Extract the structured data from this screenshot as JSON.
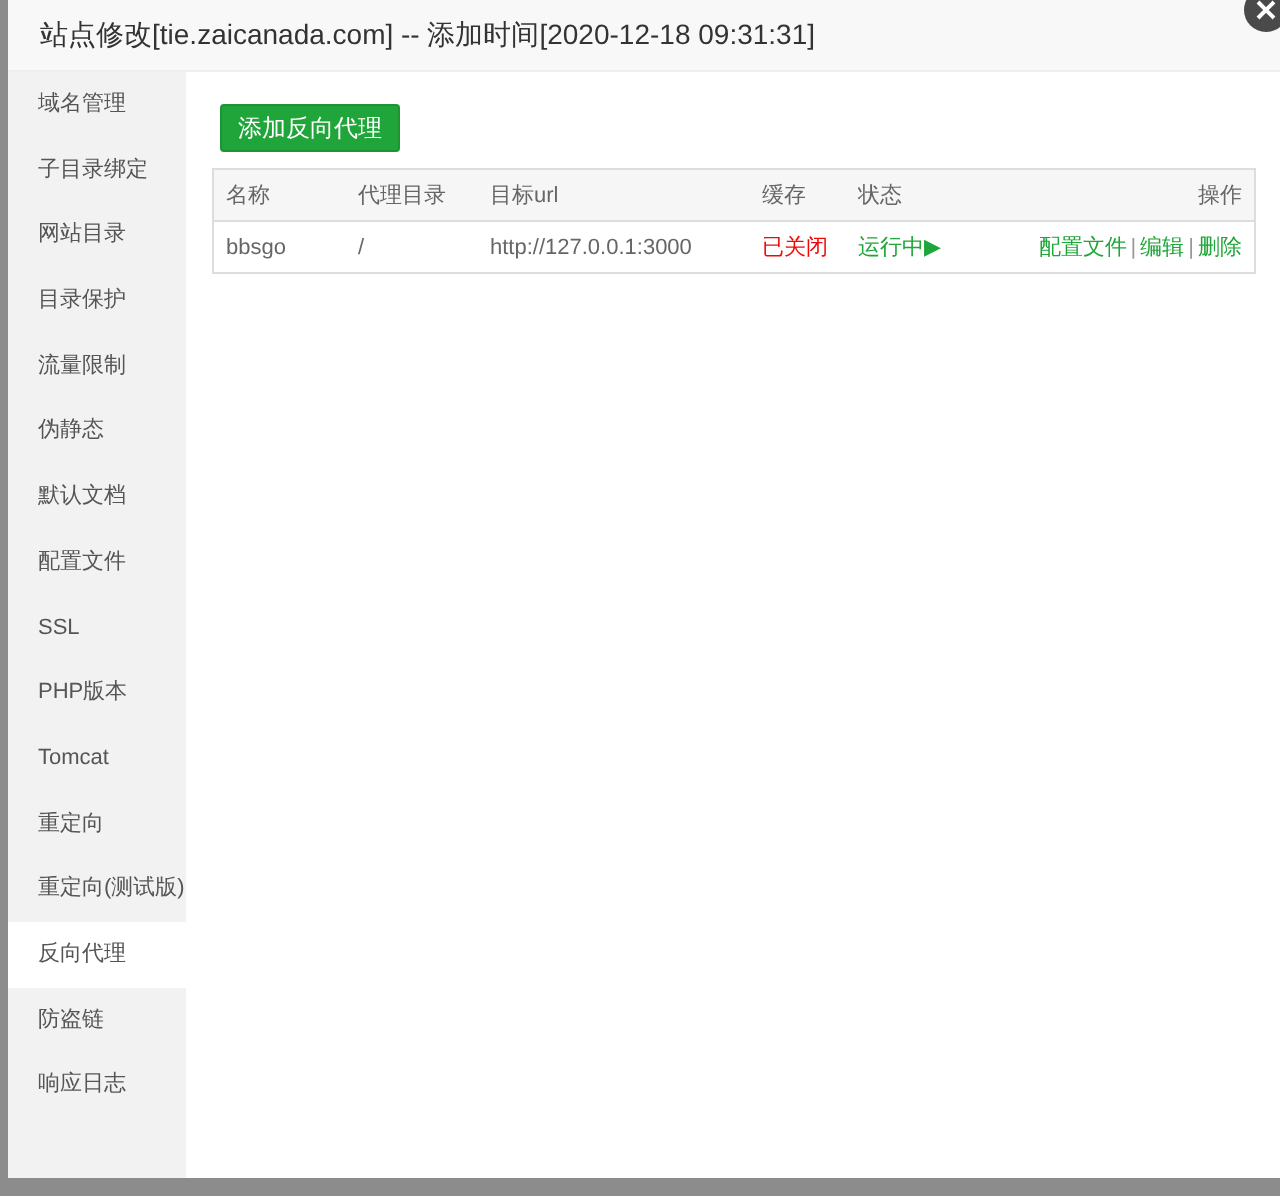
{
  "window": {
    "title": "站点修改[tie.zaicanada.com] -- 添加时间[2020-12-18 09:31:31]"
  },
  "sidebar": {
    "items": [
      {
        "label": "域名管理",
        "selected": false
      },
      {
        "label": "子目录绑定",
        "selected": false
      },
      {
        "label": "网站目录",
        "selected": false
      },
      {
        "label": "目录保护",
        "selected": false
      },
      {
        "label": "流量限制",
        "selected": false
      },
      {
        "label": "伪静态",
        "selected": false
      },
      {
        "label": "默认文档",
        "selected": false
      },
      {
        "label": "配置文件",
        "selected": false
      },
      {
        "label": "SSL",
        "selected": false
      },
      {
        "label": "PHP版本",
        "selected": false
      },
      {
        "label": "Tomcat",
        "selected": false
      },
      {
        "label": "重定向",
        "selected": false
      },
      {
        "label": "重定向(测试版)",
        "selected": false
      },
      {
        "label": "反向代理",
        "selected": true
      },
      {
        "label": "防盗链",
        "selected": false
      },
      {
        "label": "响应日志",
        "selected": false
      }
    ]
  },
  "add_button": "添加反向代理",
  "table": {
    "columns": [
      "名称",
      "代理目录",
      "目标url",
      "缓存",
      "状态",
      "操作"
    ],
    "rows": [
      {
        "name": "bbsgo",
        "path": "/",
        "url": "http://127.0.0.1:3000",
        "cache": {
          "label": "已关闭",
          "on": false
        },
        "status": {
          "label": "运行中▶",
          "running": true
        },
        "actions": [
          "配置文件",
          "编辑",
          "删除"
        ],
        "separators": [
          "|",
          "|"
        ]
      }
    ]
  }
}
